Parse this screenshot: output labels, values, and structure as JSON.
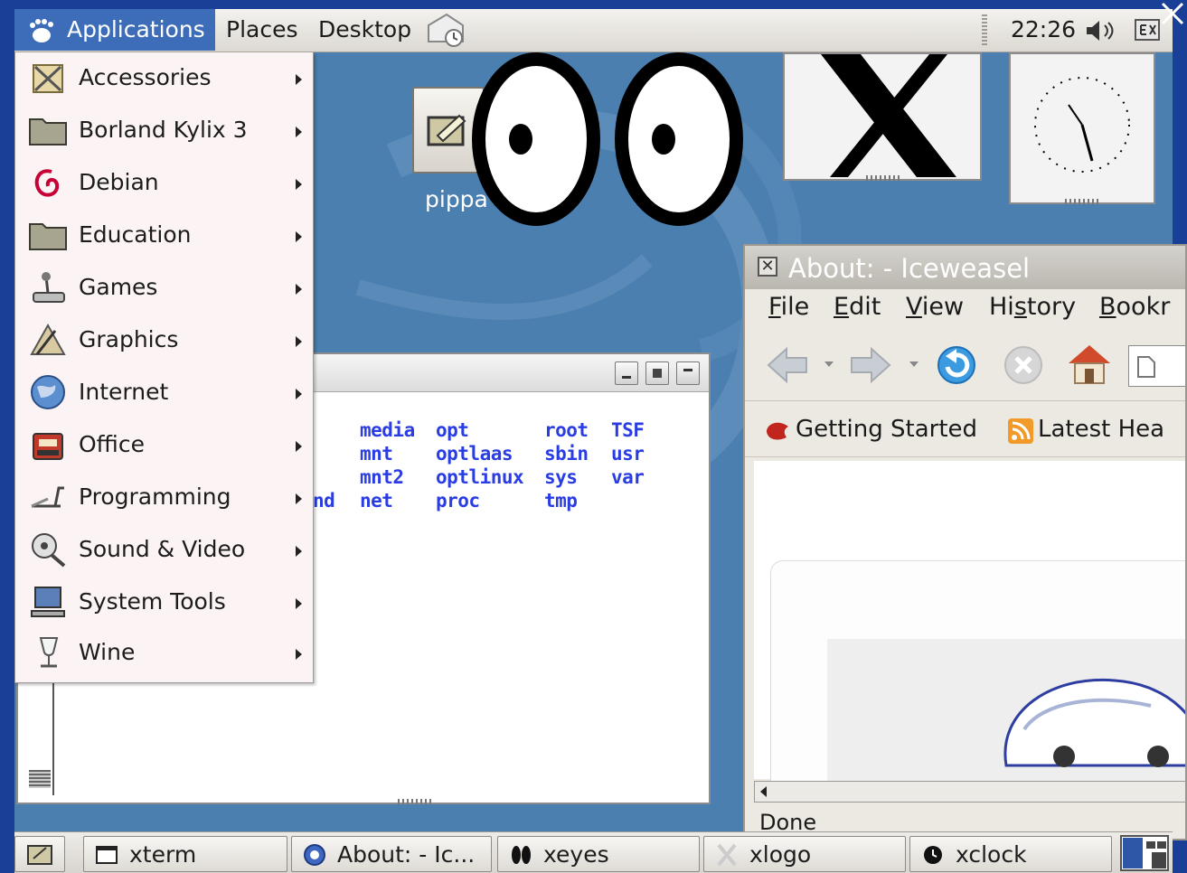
{
  "top_panel": {
    "menus": {
      "applications": "Applications",
      "places": "Places",
      "desktop": "Desktop"
    },
    "clock": "22:26"
  },
  "apps_menu": {
    "items": [
      {
        "label": "Accessories",
        "icon": "accessories-icon"
      },
      {
        "label": "Borland Kylix 3",
        "icon": "folder-icon"
      },
      {
        "label": "Debian",
        "icon": "debian-swirl-icon"
      },
      {
        "label": "Education",
        "icon": "folder-icon"
      },
      {
        "label": "Games",
        "icon": "joystick-icon"
      },
      {
        "label": "Graphics",
        "icon": "graphics-icon"
      },
      {
        "label": "Internet",
        "icon": "globe-icon"
      },
      {
        "label": "Office",
        "icon": "typewriter-icon"
      },
      {
        "label": "Programming",
        "icon": "programming-icon"
      },
      {
        "label": "Sound & Video",
        "icon": "multimedia-icon"
      },
      {
        "label": "System Tools",
        "icon": "computer-icon"
      },
      {
        "label": "Wine",
        "icon": "wine-glass-icon"
      }
    ]
  },
  "desktop": {
    "icon_label": "pippa"
  },
  "xterm": {
    "ls_columns": [
      [
        "nd"
      ],
      [
        "media",
        "mnt",
        "mnt2",
        "net"
      ],
      [
        "opt",
        "optlaas",
        "optlinux",
        "proc"
      ],
      [
        "root",
        "sbin",
        "sys",
        "tmp"
      ],
      [
        "TSF",
        "usr",
        "var"
      ]
    ]
  },
  "iceweasel": {
    "title": "About: - Iceweasel",
    "menu": [
      {
        "label": "File",
        "mnemonic": "F",
        "rest": "ile"
      },
      {
        "label": "Edit",
        "mnemonic": "E",
        "rest": "dit"
      },
      {
        "label": "View",
        "mnemonic": "V",
        "rest": "iew"
      },
      {
        "label": "History",
        "pre": "Hi",
        "mnemonic": "s",
        "rest": "tory"
      },
      {
        "label": "Bookr",
        "mnemonic": "B",
        "rest": "ookr"
      }
    ],
    "bookmarks": [
      "Getting Started",
      "Latest Hea"
    ],
    "status": "Done"
  },
  "taskbar": {
    "items": [
      "xterm",
      "About: - Ic...",
      "xeyes",
      "xlogo",
      "xclock"
    ]
  },
  "colors": {
    "panel_highlight": "#3d6db8",
    "desktop": "#4a7fb0",
    "ls_text": "#2a3de2"
  }
}
